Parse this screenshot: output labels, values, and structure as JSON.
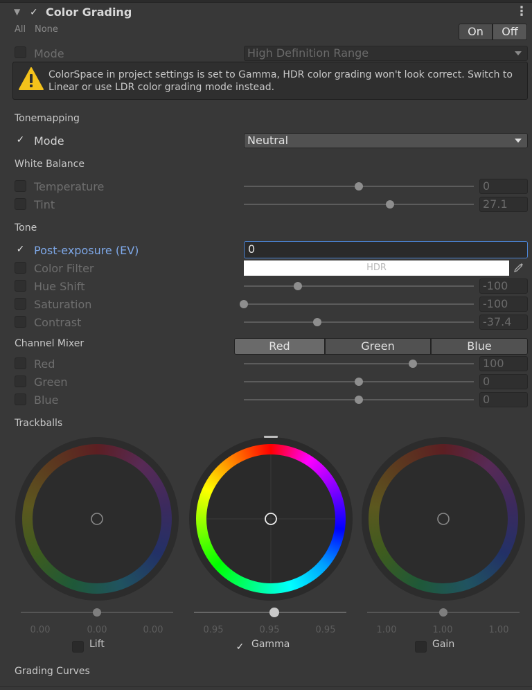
{
  "header": {
    "title": "Color Grading",
    "enabled_check": "✓",
    "menu_glyph": "⋮",
    "fold_glyph": "▼"
  },
  "toggles": {
    "all": "All",
    "none": "None",
    "on": "On",
    "off": "Off"
  },
  "mode_row": {
    "label": "Mode",
    "value": "High Definition Range"
  },
  "warning": {
    "icon": "warning-icon",
    "text": "ColorSpace in project settings is set to Gamma, HDR color grading won't look correct. Switch to Linear or use LDR color grading mode instead."
  },
  "tonemapping": {
    "section": "Tonemapping",
    "mode_label": "Mode",
    "mode_value": "Neutral",
    "check": "✓"
  },
  "white_balance": {
    "section": "White Balance",
    "temperature": {
      "label": "Temperature",
      "value": "0",
      "fraction": 0.5
    },
    "tint": {
      "label": "Tint",
      "value": "27.1",
      "fraction": 0.6355
    }
  },
  "tone": {
    "section": "Tone",
    "post_exposure": {
      "label": "Post-exposure (EV)",
      "value": "0",
      "check": "✓"
    },
    "color_filter": {
      "label": "Color Filter",
      "bar_text": "HDR",
      "picker_icon": "eyedropper-icon"
    },
    "hue_shift": {
      "label": "Hue Shift",
      "value": "-100",
      "fraction": 0.235
    },
    "saturation": {
      "label": "Saturation",
      "value": "-100",
      "fraction": 0.0
    },
    "contrast": {
      "label": "Contrast",
      "value": "-37.4",
      "fraction": 0.3187
    }
  },
  "channel_mixer": {
    "section": "Channel Mixer",
    "tabs": [
      "Red",
      "Green",
      "Blue"
    ],
    "red": {
      "label": "Red",
      "value": "100",
      "fraction": 0.735
    },
    "green": {
      "label": "Green",
      "value": "0",
      "fraction": 0.5
    },
    "blue": {
      "label": "Blue",
      "value": "0",
      "fraction": 0.5
    }
  },
  "trackballs": {
    "section": "Trackballs",
    "wheels": [
      {
        "label": "Lift",
        "values": [
          "0.00",
          "0.00",
          "0.00"
        ],
        "checked": false,
        "active": false
      },
      {
        "label": "Gamma",
        "values": [
          "0.95",
          "0.95",
          "0.95"
        ],
        "checked": true,
        "active": true
      },
      {
        "label": "Gain",
        "values": [
          "1.00",
          "1.00",
          "1.00"
        ],
        "checked": false,
        "active": false
      }
    ],
    "check": "✓"
  },
  "grading_curves": {
    "section": "Grading Curves"
  },
  "colors": {
    "accent_blue": "#4b84d4",
    "label_blue": "#7ea8e8",
    "background": "#383838",
    "warning_yellow": "#f4c21b"
  }
}
